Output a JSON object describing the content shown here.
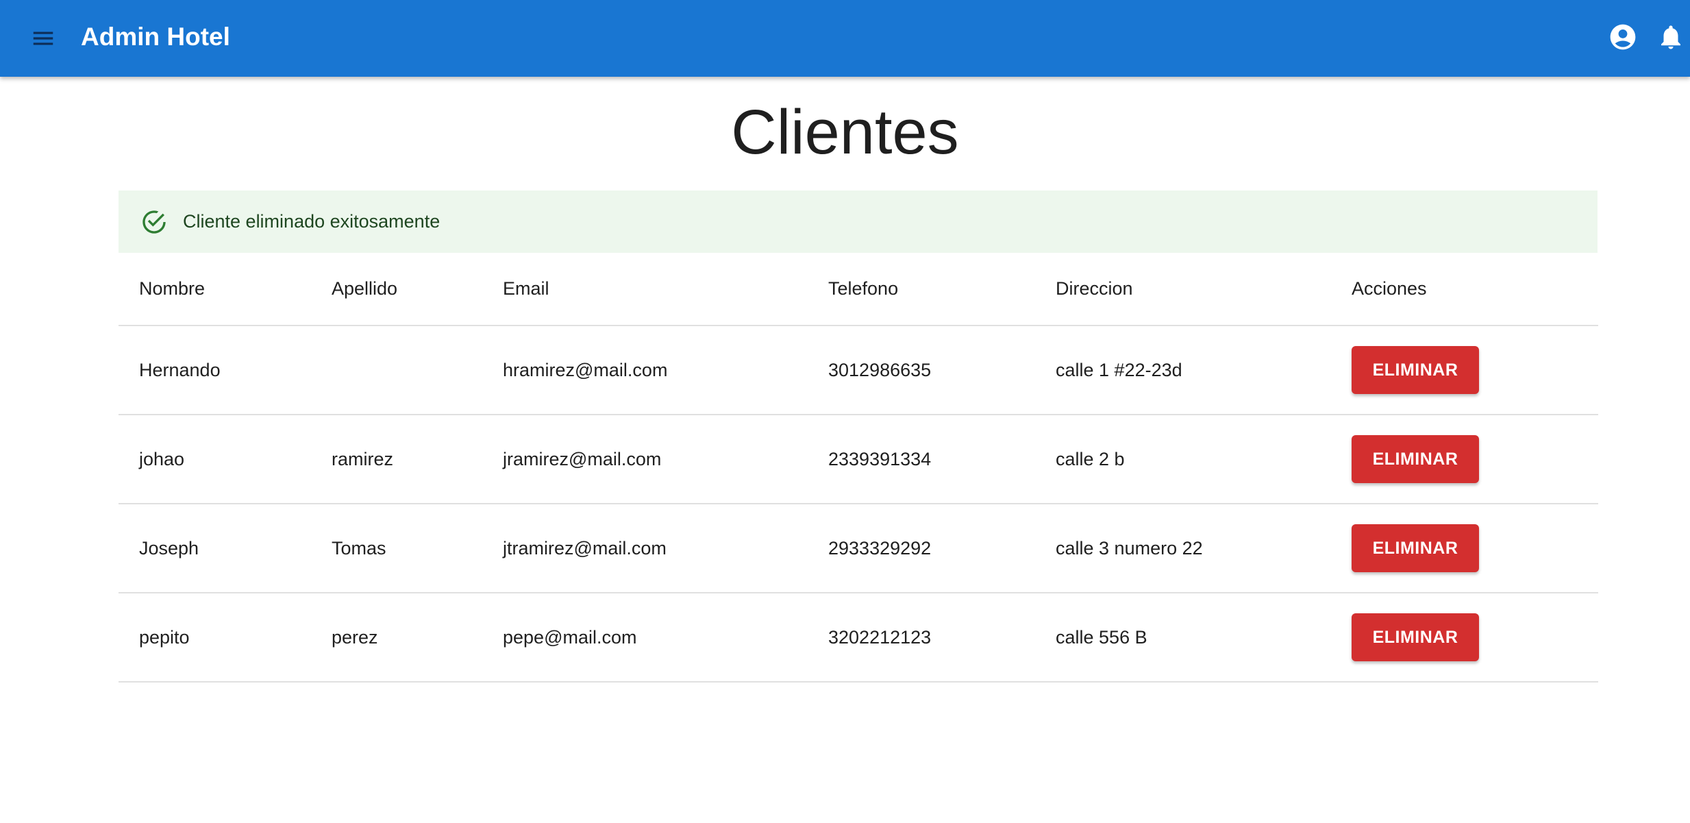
{
  "appbar": {
    "title": "Admin Hotel",
    "menu_icon": "hamburger-menu-icon",
    "account_icon": "account-circle-icon",
    "notification_icon": "bell-icon",
    "color": "#1976d2"
  },
  "page": {
    "title": "Clientes"
  },
  "alert": {
    "icon": "check-circle-outline-icon",
    "message": "Cliente eliminado exitosamente",
    "background": "#edf7ed",
    "icon_color": "#2e7d32"
  },
  "table": {
    "headers": [
      "Nombre",
      "Apellido",
      "Email",
      "Telefono",
      "Direccion",
      "Acciones"
    ],
    "rows": [
      {
        "nombre": "Hernando",
        "apellido": "",
        "email": "hramirez@mail.com",
        "telefono": "3012986635",
        "direccion": "calle 1 #22-23d",
        "accion": "ELIMINAR"
      },
      {
        "nombre": "johao",
        "apellido": "ramirez",
        "email": "jramirez@mail.com",
        "telefono": "2339391334",
        "direccion": "calle 2 b",
        "accion": "ELIMINAR"
      },
      {
        "nombre": "Joseph",
        "apellido": "Tomas",
        "email": "jtramirez@mail.com",
        "telefono": "2933329292",
        "direccion": "calle 3 numero 22",
        "accion": "ELIMINAR"
      },
      {
        "nombre": "pepito",
        "apellido": "perez",
        "email": "pepe@mail.com",
        "telefono": "3202212123",
        "direccion": "calle 556 B",
        "accion": "ELIMINAR"
      }
    ],
    "delete_button_color": "#d32f2f"
  }
}
